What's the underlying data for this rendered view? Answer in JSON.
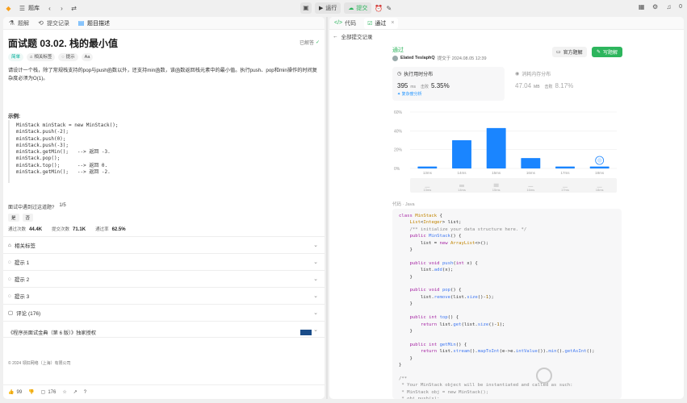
{
  "topbar": {
    "library": "题库",
    "run": "运行",
    "submit": "提交",
    "likes_count": "0"
  },
  "left_tabs": [
    "题解",
    "提交记录",
    "题目描述"
  ],
  "problem": {
    "title": "面试题 03.02. 栈的最小值",
    "solved": "已解答",
    "tags": [
      "简单",
      "相关标签",
      "提示",
      "Aa"
    ],
    "description": "请设计一个栈，除了常规栈支持的pop与push函数以外，还支持min函数，该函数返回栈元素中的最小值。执行push、pop和min操作的时间复杂度必须为O(1)。",
    "example_title": "示例:",
    "example_code": "MinStack minStack = new MinStack();\nminStack.push(-2);\nminStack.push(0);\nminStack.push(-3);\nminStack.getMin();   --> 返回 -3.\nminStack.pop();\nminStack.top();      --> 返回 0.\nminStack.getMin();   --> 返回 -2.",
    "met_question": "面试中遇到过这道题?",
    "met_ratio": "1/5",
    "yes": "是",
    "no": "否",
    "stats": [
      {
        "label": "通过次数",
        "value": "44.4K"
      },
      {
        "label": "提交次数",
        "value": "71.1K"
      },
      {
        "label": "通过率",
        "value": "62.5%"
      }
    ],
    "accordions": [
      "相关标签",
      "提示 1",
      "提示 2",
      "提示 3",
      "评论 (176)"
    ],
    "book": "《程序员面试金典（第 6 版）》独家授权",
    "copyright": "© 2024 领扣网络（上海）有限公司",
    "bottom": {
      "likes": "99",
      "comments": "176"
    }
  },
  "right_tabs": [
    "代码",
    "通过"
  ],
  "result": {
    "back": "全部提交记录",
    "status": "通过",
    "user": "Elated TeslaphQ",
    "submitted": "提交于 2024.08.05 12:39",
    "solution_btn": "官方题解",
    "write_btn": "写题解",
    "runtime_label": "执行用时分布",
    "runtime_value": "395",
    "runtime_unit": "ms",
    "runtime_beats_label": "击败",
    "runtime_beats": "5.35%",
    "complexity_link": "复杂度分析",
    "memory_label": "消耗内存分布",
    "memory_value": "47.04",
    "memory_unit": "MB",
    "memory_beats_label": "击败",
    "memory_beats": "8.17%",
    "code_header": "代码",
    "code_lang": "Java"
  },
  "chart_data": {
    "type": "bar",
    "categories": [
      "13ms",
      "14ms",
      "15ms",
      "16ms",
      "17ms",
      "18ms"
    ],
    "values": [
      2,
      30,
      43,
      11,
      2,
      2
    ],
    "ylim": [
      0,
      60
    ],
    "yticks": [
      "0%",
      "20%",
      "40%",
      "60%"
    ],
    "minimap_labels": [
      "13ms",
      "14ms",
      "15ms",
      "16ms",
      "17ms",
      "18ms"
    ],
    "bar_color": "#1a85ff"
  }
}
